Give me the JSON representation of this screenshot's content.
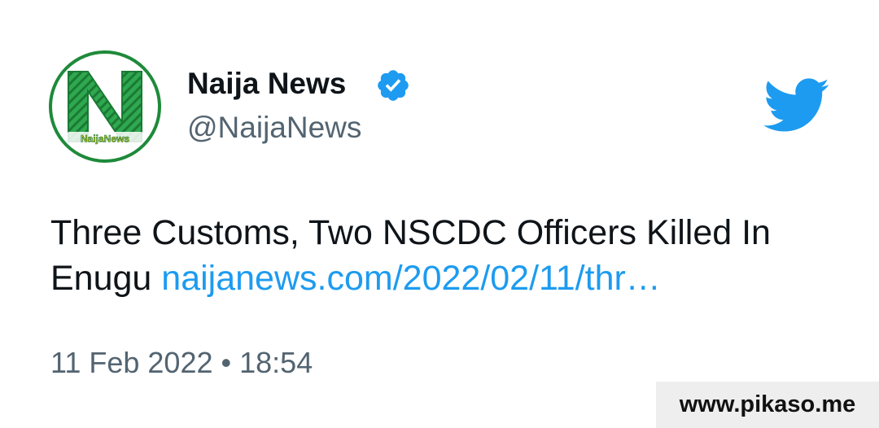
{
  "author": {
    "name": "Naija News",
    "handle": "@NaijaNews",
    "logo_text": "NaijaNews",
    "verified": true
  },
  "tweet": {
    "text": "Three Customs, Two NSCDC Officers Killed In Enugu",
    "link": "naijanews.com/2022/02/11/thr…"
  },
  "meta": {
    "date": "11 Feb 2022",
    "separator": "•",
    "time": "18:54"
  },
  "watermark": "www.pikaso.me",
  "icons": {
    "avatar": "naija-news-logo",
    "verified": "verified-badge-icon",
    "brand": "twitter-bird-icon"
  },
  "colors": {
    "accent": "#1d9bf0",
    "logo_green": "#1e8a3a",
    "secondary_text": "#536471"
  }
}
